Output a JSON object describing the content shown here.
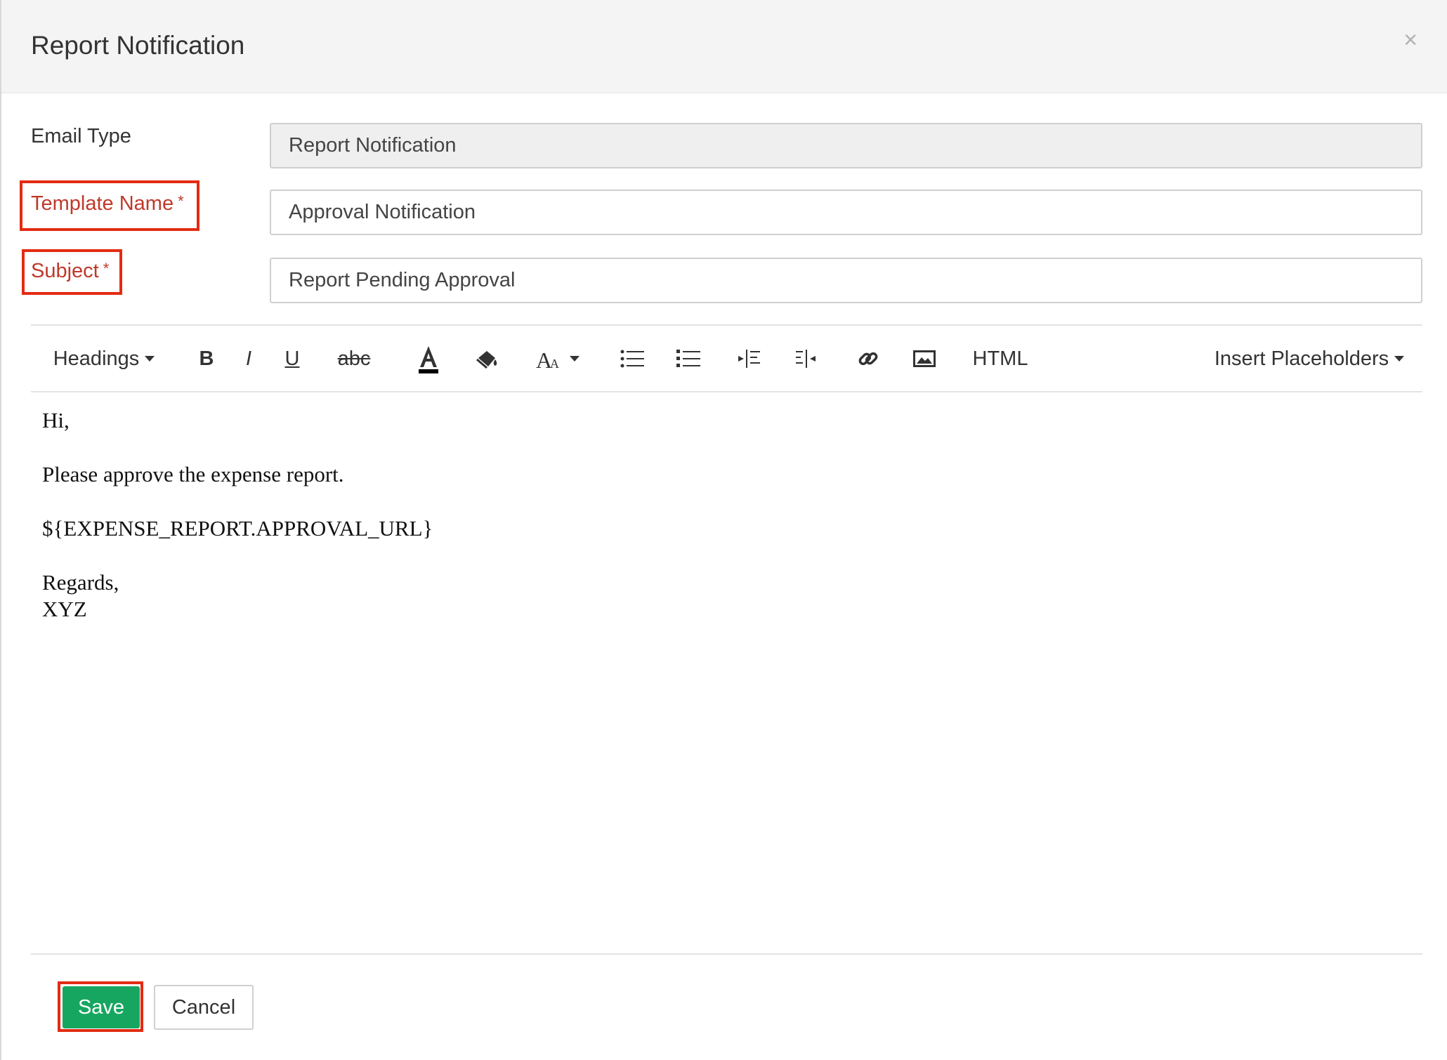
{
  "header": {
    "title": "Report Notification",
    "close_glyph": "×"
  },
  "form": {
    "email_type": {
      "label": "Email Type",
      "value": "Report Notification"
    },
    "template_name": {
      "label": "Template Name",
      "required_mark": "*",
      "value": "Approval Notification"
    },
    "subject": {
      "label": "Subject",
      "required_mark": "*",
      "value": "Report Pending Approval"
    }
  },
  "toolbar": {
    "headings": "Headings",
    "bold": "B",
    "italic": "I",
    "underline": "U",
    "strikethrough": "abc",
    "html": "HTML",
    "insert_placeholders": "Insert Placeholders",
    "icons": [
      "font-color-icon",
      "highlight-icon",
      "font-size-icon",
      "bulleted-list-icon",
      "numbered-list-icon",
      "indent-icon",
      "outdent-icon",
      "link-icon",
      "image-icon"
    ]
  },
  "editor": {
    "line1": "Hi,",
    "line2": "Please approve the expense report.",
    "line3": "${EXPENSE_REPORT.APPROVAL_URL}",
    "line4": "Regards,",
    "line5": "XYZ"
  },
  "footer": {
    "save": "Save",
    "cancel": "Cancel"
  },
  "colors": {
    "accent_green": "#17a660",
    "required_red": "#c0392b",
    "highlight_red": "#e32b12"
  }
}
